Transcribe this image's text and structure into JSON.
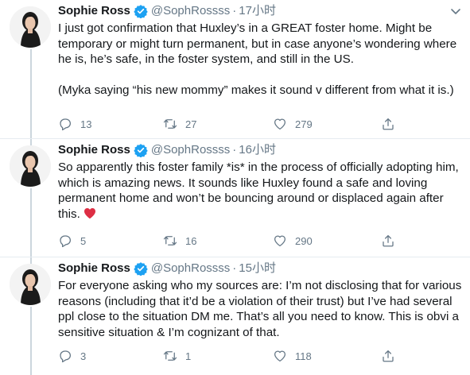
{
  "colors": {
    "verified": "#1da1f2",
    "muted": "#657786",
    "text": "#14171a",
    "heart_emoji": "#dd2e44"
  },
  "tweets": [
    {
      "name": "Sophie Ross",
      "handle": "@SophRossss",
      "dot": "·",
      "time": "17小时",
      "text": "I just got confirmation that Huxley’s in a GREAT foster home. Might be temporary or might turn permanent, but in case anyone’s wondering where he is, he’s safe, in the foster system, and still in the US.\n\n(Myka saying “his new mommy” makes it sound v different from what it is.)",
      "replies": "13",
      "retweets": "27",
      "likes": "279"
    },
    {
      "name": "Sophie Ross",
      "handle": "@SophRossss",
      "dot": "·",
      "time": "16小时",
      "text": "So apparently this foster family *is* in the process of officially adopting him, which is amazing news. It sounds like Huxley found a safe and loving permanent home and won’t be bouncing around or displaced again after this.",
      "emoji": "red-heart",
      "replies": "5",
      "retweets": "16",
      "likes": "290"
    },
    {
      "name": "Sophie Ross",
      "handle": "@SophRossss",
      "dot": "·",
      "time": "15小时",
      "text": "For everyone asking who my sources are: I’m not disclosing that for various reasons (including that it’d be a violation of their trust) but I’ve had several ppl close to the situation DM me. That’s all you need to know. This is obvi a sensitive situation & I’m cognizant of that.",
      "replies": "3",
      "retweets": "1",
      "likes": "118"
    }
  ]
}
